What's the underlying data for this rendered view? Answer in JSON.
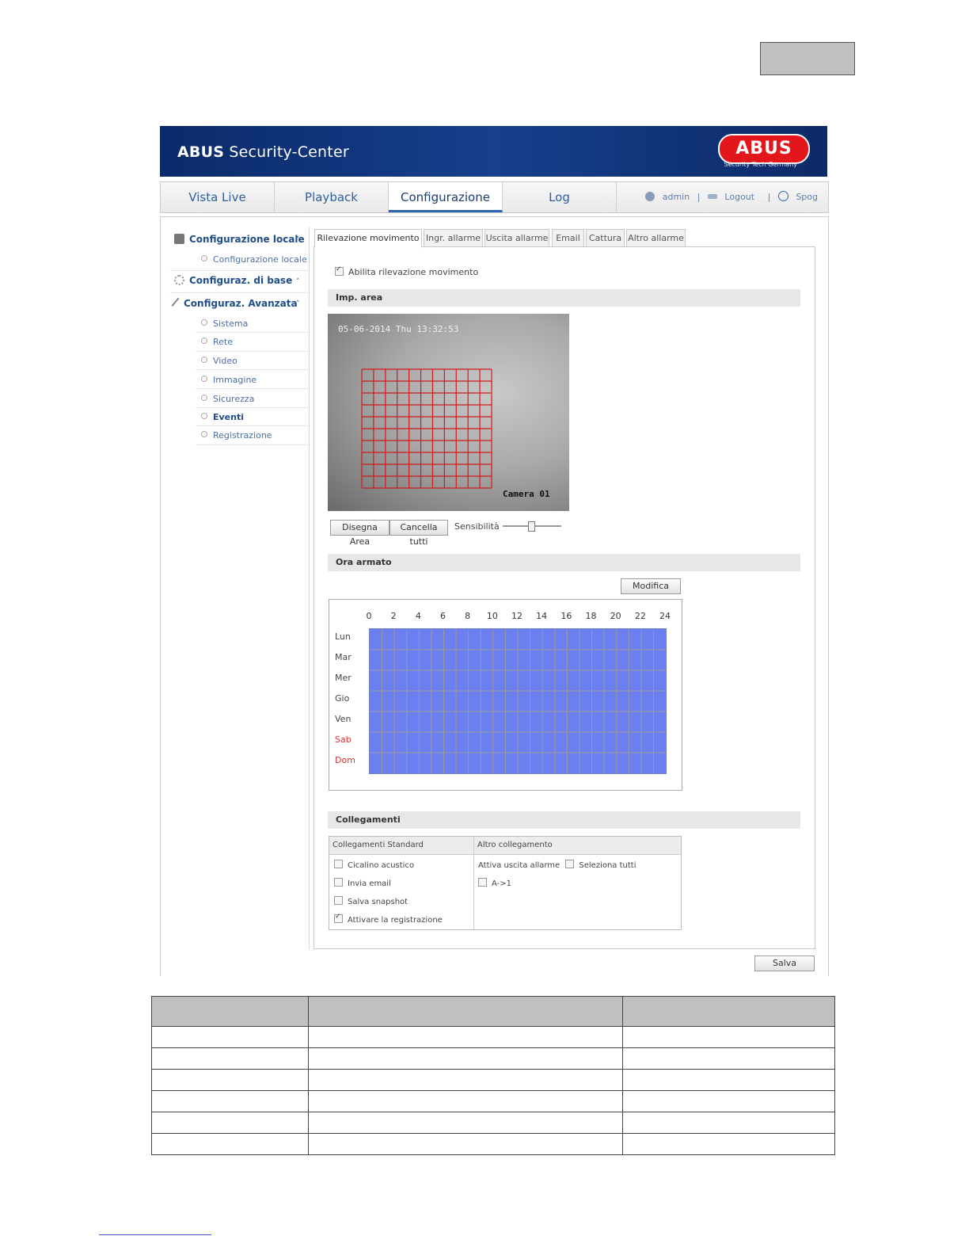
{
  "app": {
    "title_bold": "ABUS",
    "title_rest": " Security-Center",
    "logo_text": "ABUS",
    "logo_subtitle": "Security Tech Germany"
  },
  "nav": {
    "tabs": [
      {
        "label": "Vista Live"
      },
      {
        "label": "Playback"
      },
      {
        "label": "Configurazione",
        "active": true
      },
      {
        "label": "Log"
      }
    ],
    "user": "admin",
    "logout": "Logout",
    "language": "Spog",
    "separator": "|"
  },
  "sidebar": {
    "groups": [
      {
        "label": "Configurazione locale",
        "caret": "˅",
        "icon": "camera-config-icon"
      },
      {
        "label": "Configuraz. di base",
        "caret": "˄",
        "icon": "gear-icon"
      },
      {
        "label": "Configuraz. Avanzata",
        "caret": "˅",
        "icon": "wrench-icon"
      }
    ],
    "local_items": [
      "Configurazione locale"
    ],
    "advanced_items": [
      "Sistema",
      "Rete",
      "Video",
      "Immagine",
      "Sicurezza",
      "Eventi",
      "Registrazione"
    ]
  },
  "tabs": [
    "Rilevazione movimento",
    "Ingr. allarme",
    "Uscita allarme",
    "Email",
    "Cattura",
    "Altro allarme"
  ],
  "motion": {
    "enable_label": "Abilita rilevazione movimento",
    "enabled": true,
    "area_section": "Imp. area",
    "osd_datetime": "05-06-2014 Thu 13:32:53",
    "osd_camera": "Camera 01",
    "draw_area": "Disegna Area",
    "clear_all": "Cancella tutti",
    "sensitivity_label": "Sensibilità",
    "sensitivity_level": 0.5
  },
  "schedule": {
    "section": "Ora armato",
    "edit_button": "Modifica",
    "hours": [
      "0",
      "2",
      "4",
      "6",
      "8",
      "10",
      "12",
      "14",
      "16",
      "18",
      "20",
      "22",
      "24"
    ],
    "days": [
      "Lun",
      "Mar",
      "Mer",
      "Gio",
      "Ven",
      "Sab",
      "Dom"
    ],
    "grid_color": "#6b7ff0"
  },
  "linkage": {
    "section": "Collegamenti",
    "standard_header": "Collegamenti Standard",
    "other_header": "Altro collegamento",
    "standard_items": [
      {
        "label": "Cicalino acustico",
        "checked": false
      },
      {
        "label": "Invia email",
        "checked": false
      },
      {
        "label": "Salva snapshot",
        "checked": false
      },
      {
        "label": "Attivare la registrazione",
        "checked": true
      }
    ],
    "alarm_output_label": "Attiva uscita allarme",
    "select_all": "Seleziona tutti",
    "output_item": "A->1"
  },
  "save_button": "Salva",
  "colors": {
    "header_blue": "#163f8c",
    "logo_red": "#e3161b",
    "link_blue": "#2f5fa0",
    "motion_grid": "#d11a1a"
  }
}
